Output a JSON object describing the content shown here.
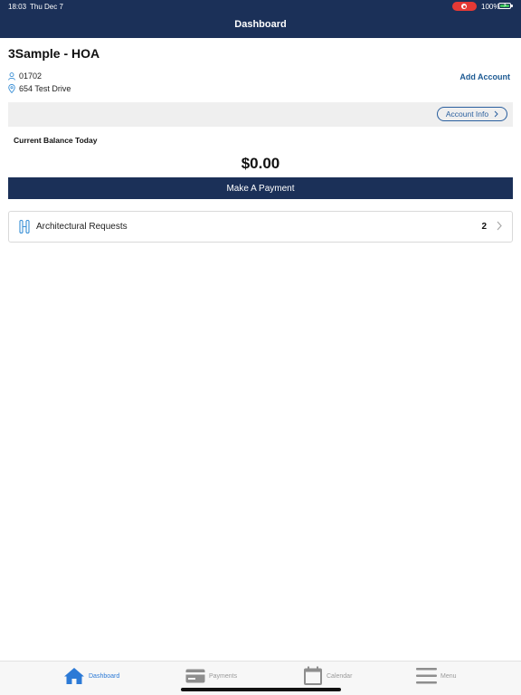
{
  "status_bar": {
    "time": "18:03",
    "date": "Thu Dec 7",
    "battery": "100%"
  },
  "header": {
    "title": "Dashboard"
  },
  "account": {
    "name": "3Sample - HOA",
    "number": "01702",
    "address": "654 Test Drive",
    "add_account_label": "Add Account",
    "account_info_label": "Account Info"
  },
  "balance": {
    "label": "Current Balance Today",
    "amount": "$0.00",
    "pay_button_label": "Make A Payment"
  },
  "requests": {
    "label": "Architectural Requests",
    "count": "2"
  },
  "tabs": [
    {
      "label": "Dashboard",
      "icon": "home-icon",
      "active": true
    },
    {
      "label": "Payments",
      "icon": "credit-card-icon",
      "active": false
    },
    {
      "label": "Calendar",
      "icon": "calendar-icon",
      "active": false
    },
    {
      "label": "Menu",
      "icon": "hamburger-menu-icon",
      "active": false
    }
  ],
  "colors": {
    "primary_navy": "#1b3058",
    "link_blue": "#1d5a93",
    "active_tab_blue": "#2c7ad6",
    "recording_red": "#e53935",
    "battery_green": "#3cc45a"
  }
}
